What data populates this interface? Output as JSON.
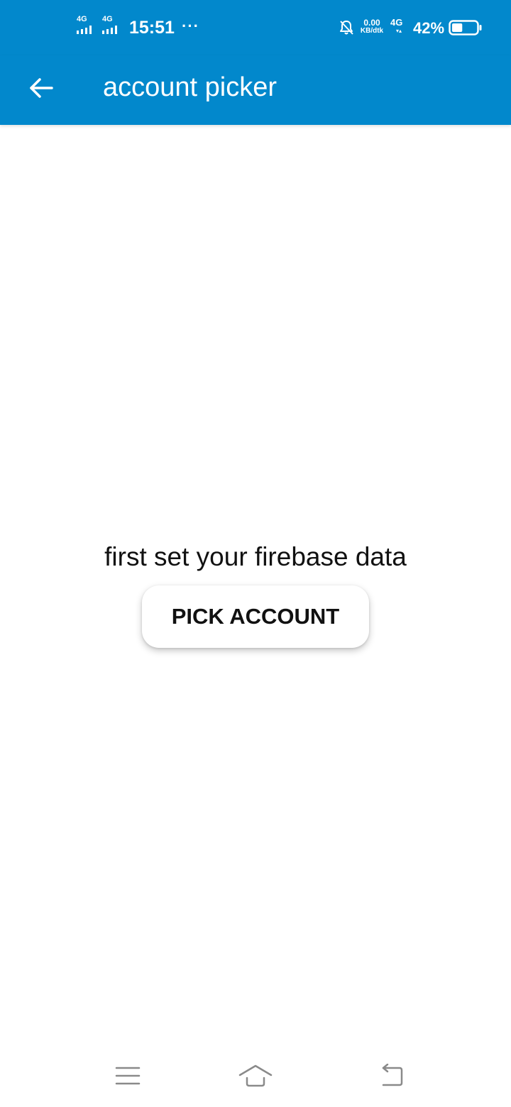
{
  "status_bar": {
    "sim1_network": "4G",
    "sim2_network": "4G",
    "time": "15:51",
    "more_indicator": "···",
    "notification_icon": "bell-off-icon",
    "speed_value": "0.00",
    "speed_unit": "KB/dtk",
    "data_network": "4G",
    "data_arrows": "▾▴",
    "battery_percent": "42%",
    "battery_level": 0.42
  },
  "app_bar": {
    "back_icon": "arrow-left-icon",
    "title": "account picker",
    "color": "#0288cc"
  },
  "content": {
    "message": "first set your firebase data",
    "pick_button_label": "PICK ACCOUNT"
  },
  "nav_bar": {
    "menu_icon": "menu-icon",
    "home_icon": "home-icon",
    "back_icon": "back-icon"
  }
}
